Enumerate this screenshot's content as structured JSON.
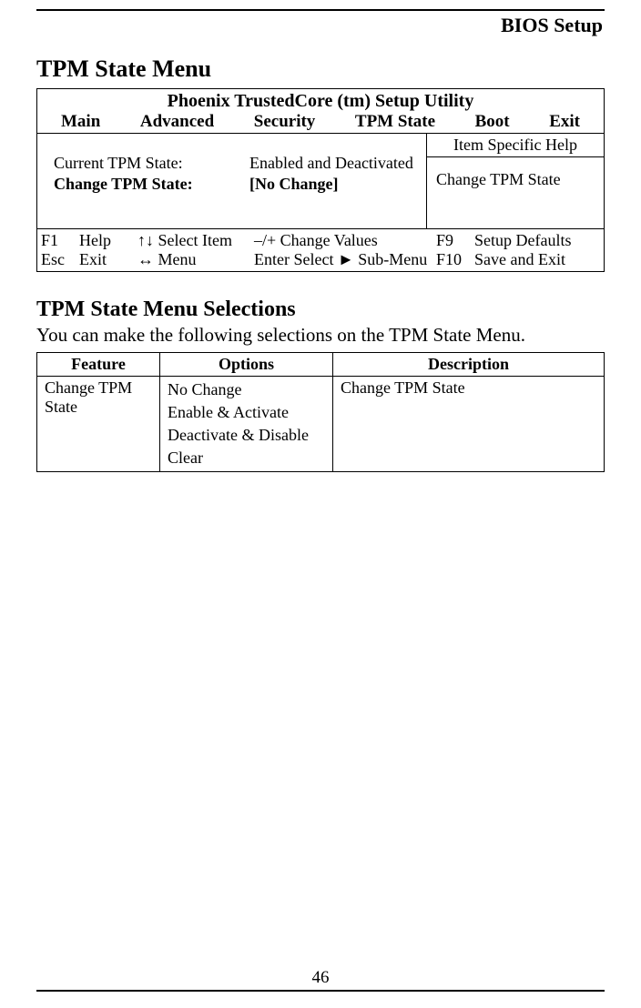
{
  "header": "BIOS Setup",
  "section_title": "TPM State Menu",
  "bios": {
    "title": "Phoenix TrustedCore (tm) Setup Utility",
    "tabs": [
      "Main",
      "Advanced",
      "Security",
      "TPM State",
      "Boot",
      "Exit"
    ],
    "rows": [
      {
        "label": "Current TPM State:",
        "value": "Enabled and Deactivated",
        "bold": false
      },
      {
        "label": "Change TPM State:",
        "value": "[No Change]",
        "bold": true
      }
    ],
    "help_title": "Item Specific Help",
    "help_body": "Change TPM State",
    "footer": {
      "row1": {
        "k": "F1",
        "l": "Help",
        "s": "↑↓ Select Item",
        "v": "–/+      Change Values",
        "k2": "F9",
        "l2": "Setup Defaults"
      },
      "row2": {
        "k": "Esc",
        "l": "Exit",
        "s": "↔ Menu",
        "v": "Enter Select ► Sub-Menu",
        "k2": "F10",
        "l2": "Save and Exit"
      }
    }
  },
  "subsection_title": "TPM State Menu Selections",
  "intro": "You can make the following selections on the TPM State Menu.",
  "table": {
    "headers": [
      "Feature",
      "Options",
      "Description"
    ],
    "row": {
      "feature": "Change TPM State",
      "options": [
        "No Change",
        "Enable & Activate",
        "Deactivate & Disable",
        "Clear"
      ],
      "description": "Change TPM State"
    }
  },
  "page_number": "46"
}
